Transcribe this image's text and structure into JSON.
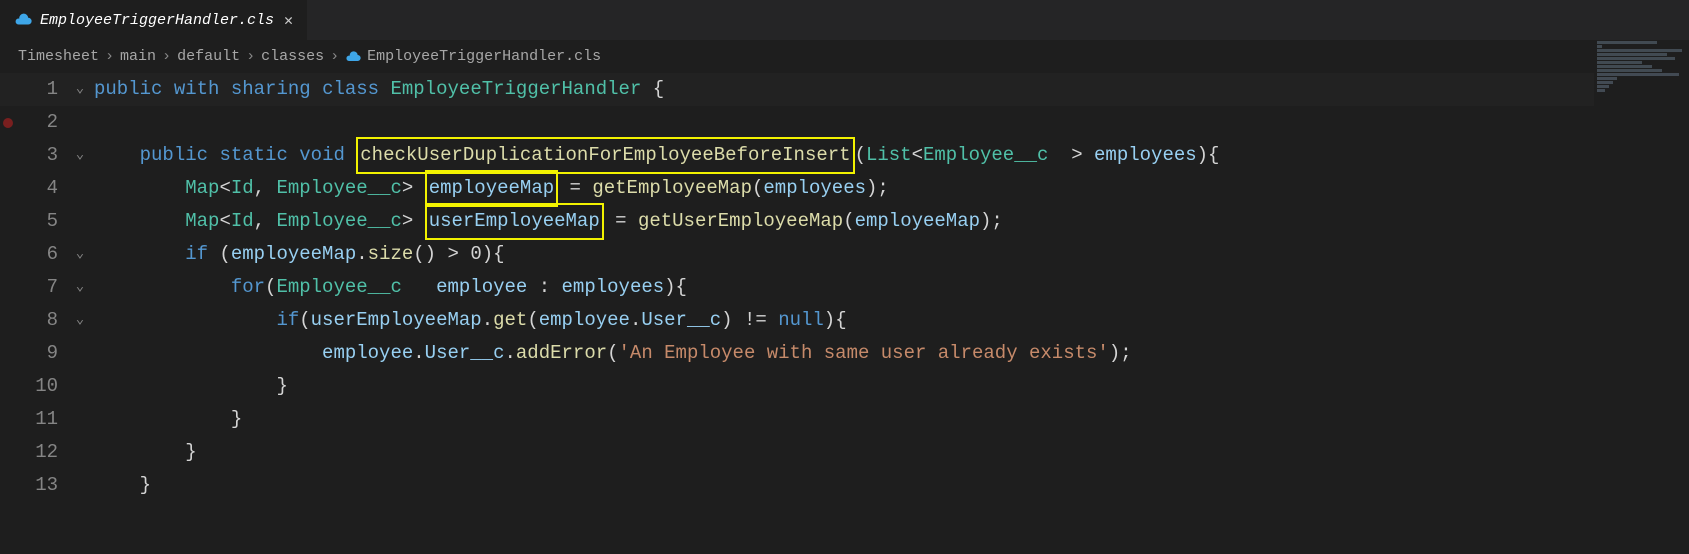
{
  "tab": {
    "filename": "EmployeeTriggerHandler.cls"
  },
  "breadcrumb": {
    "parts": [
      "Timesheet",
      "main",
      "default",
      "classes",
      "EmployeeTriggerHandler.cls"
    ]
  },
  "code": {
    "line1": {
      "kw_public": "public",
      "with": "with",
      "sharing": "sharing",
      "kw_class": "class",
      "classname": "EmployeeTriggerHandler",
      "brace": "{"
    },
    "line3": {
      "kw_public": "public",
      "kw_static": "static",
      "kw_void": "void",
      "method": "checkUserDuplicationForEmployeeBeforeInsert",
      "paren_open": "(",
      "list": "List",
      "lt": "<",
      "emp_c": "Employee__c",
      "gt": ">",
      "employees": "employees",
      "paren_close_brace": "){"
    },
    "line4": {
      "map": "Map",
      "lt": "<",
      "id": "Id",
      "comma": ", ",
      "emp_c": "Employee__c",
      "gt": ">",
      "var": "employeeMap",
      "eq": " = ",
      "call": "getEmployeeMap",
      "popen": "(",
      "arg": "employees",
      "pclose": ");"
    },
    "line5": {
      "map": "Map",
      "lt": "<",
      "id": "Id",
      "comma": ", ",
      "emp_c": "Employee__c",
      "gt": ">",
      "var": "userEmployeeMap",
      "eq": " = ",
      "call": "getUserEmployeeMap",
      "popen": "(",
      "arg": "employeeMap",
      "pclose": ");"
    },
    "line6": {
      "kw_if": "if",
      "popen": " (",
      "var": "employeeMap",
      "dot": ".",
      "size": "size",
      "paren": "()",
      "gt": " > ",
      "zero": "0",
      "close": "){"
    },
    "line7": {
      "kw_for": "for",
      "popen": "(",
      "type": "Employee__c",
      "var": "employee",
      "colon": " : ",
      "coll": "employees",
      "close": "){"
    },
    "line8": {
      "kw_if": "if",
      "popen": "(",
      "var": "userEmployeeMap",
      "dot": ".",
      "get": "get",
      "paren_o": "(",
      "emp": "employee",
      "dot2": ".",
      "user": "User__c",
      "paren_c": ")",
      "neq": " != ",
      "null": "null",
      "close": "){"
    },
    "line9": {
      "emp": "employee",
      "dot": ".",
      "user": "User__c",
      "dot2": ".",
      "adderr": "addError",
      "popen": "(",
      "str": "'An Employee with same user already exists'",
      "pclose": ");"
    },
    "line10": "}",
    "line11": "}",
    "line12": "}",
    "line13": "}"
  },
  "line_numbers": {
    "l1": "1",
    "l2": "2",
    "l3": "3",
    "l4": "4",
    "l5": "5",
    "l6": "6",
    "l7": "7",
    "l8": "8",
    "l9": "9",
    "l10": "10",
    "l11": "11",
    "l12": "12",
    "l13": "13"
  },
  "fold": {
    "expanded": "⌄"
  }
}
